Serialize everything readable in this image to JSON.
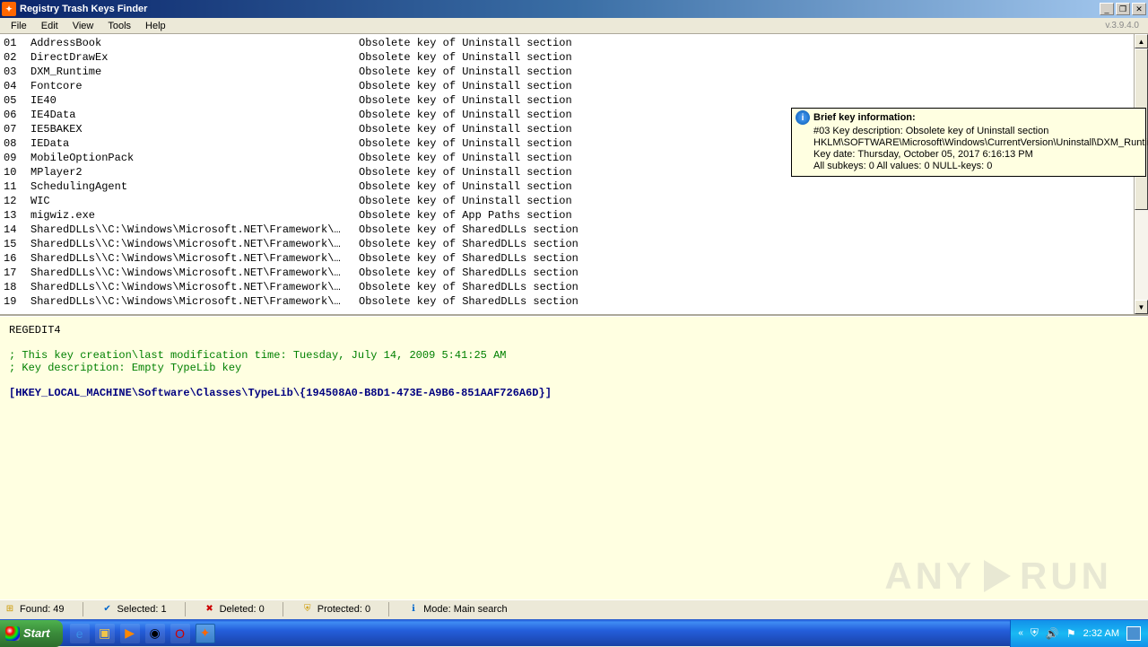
{
  "window": {
    "title": "Registry Trash Keys Finder",
    "version": "v.3.9.4.0"
  },
  "menu": {
    "file": "File",
    "edit": "Edit",
    "view": "View",
    "tools": "Tools",
    "help": "Help"
  },
  "rows": [
    {
      "num": "01",
      "name": "AddressBook",
      "desc": "Obsolete key of Uninstall section"
    },
    {
      "num": "02",
      "name": "DirectDrawEx",
      "desc": "Obsolete key of Uninstall section"
    },
    {
      "num": "03",
      "name": "DXM_Runtime",
      "desc": "Obsolete key of Uninstall section"
    },
    {
      "num": "04",
      "name": "Fontcore",
      "desc": "Obsolete key of Uninstall section"
    },
    {
      "num": "05",
      "name": "IE40",
      "desc": "Obsolete key of Uninstall section"
    },
    {
      "num": "06",
      "name": "IE4Data",
      "desc": "Obsolete key of Uninstall section"
    },
    {
      "num": "07",
      "name": "IE5BAKEX",
      "desc": "Obsolete key of Uninstall section"
    },
    {
      "num": "08",
      "name": "IEData",
      "desc": "Obsolete key of Uninstall section"
    },
    {
      "num": "09",
      "name": "MobileOptionPack",
      "desc": "Obsolete key of Uninstall section"
    },
    {
      "num": "10",
      "name": "MPlayer2",
      "desc": "Obsolete key of Uninstall section"
    },
    {
      "num": "11",
      "name": "SchedulingAgent",
      "desc": "Obsolete key of Uninstall section"
    },
    {
      "num": "12",
      "name": "WIC",
      "desc": "Obsolete key of Uninstall section"
    },
    {
      "num": "13",
      "name": "migwiz.exe",
      "desc": "Obsolete key of App Paths section"
    },
    {
      "num": "14",
      "name": "SharedDLLs\\\\C:\\Windows\\Microsoft.NET\\Framework\\…",
      "desc": "Obsolete key of SharedDLLs section"
    },
    {
      "num": "15",
      "name": "SharedDLLs\\\\C:\\Windows\\Microsoft.NET\\Framework\\…",
      "desc": "Obsolete key of SharedDLLs section"
    },
    {
      "num": "16",
      "name": "SharedDLLs\\\\C:\\Windows\\Microsoft.NET\\Framework\\…",
      "desc": "Obsolete key of SharedDLLs section"
    },
    {
      "num": "17",
      "name": "SharedDLLs\\\\C:\\Windows\\Microsoft.NET\\Framework\\…",
      "desc": "Obsolete key of SharedDLLs section"
    },
    {
      "num": "18",
      "name": "SharedDLLs\\\\C:\\Windows\\Microsoft.NET\\Framework\\…",
      "desc": "Obsolete key of SharedDLLs section"
    },
    {
      "num": "19",
      "name": "SharedDLLs\\\\C:\\Windows\\Microsoft.NET\\Framework\\…",
      "desc": "Obsolete key of SharedDLLs section"
    }
  ],
  "tooltip": {
    "title": "Brief key information:",
    "line1": "#03     Key description:  Obsolete key of Uninstall section",
    "line2": "HKLM\\SOFTWARE\\Microsoft\\Windows\\CurrentVersion\\Uninstall\\DXM_Runtime",
    "line3": "Key date: Thursday, October 05, 2017 6:16:13 PM",
    "line4": "All subkeys: 0    All values: 0   NULL-keys: 0"
  },
  "detail": {
    "header": "REGEDIT4",
    "comment1": "; This key creation\\last modification time: Tuesday, July 14, 2009 5:41:25 AM",
    "comment2": "; Key description: Empty TypeLib key",
    "key": "[HKEY_LOCAL_MACHINE\\Software\\Classes\\TypeLib\\{194508A0-B8D1-473E-A9B6-851AAF726A6D}]"
  },
  "status": {
    "found": "Found: 49",
    "selected": "Selected: 1",
    "deleted": "Deleted: 0",
    "protected": "Protected: 0",
    "mode": "Mode: Main search"
  },
  "taskbar": {
    "start": "Start",
    "time": "2:32 AM"
  },
  "watermark": {
    "left": "ANY",
    "right": "RUN"
  }
}
